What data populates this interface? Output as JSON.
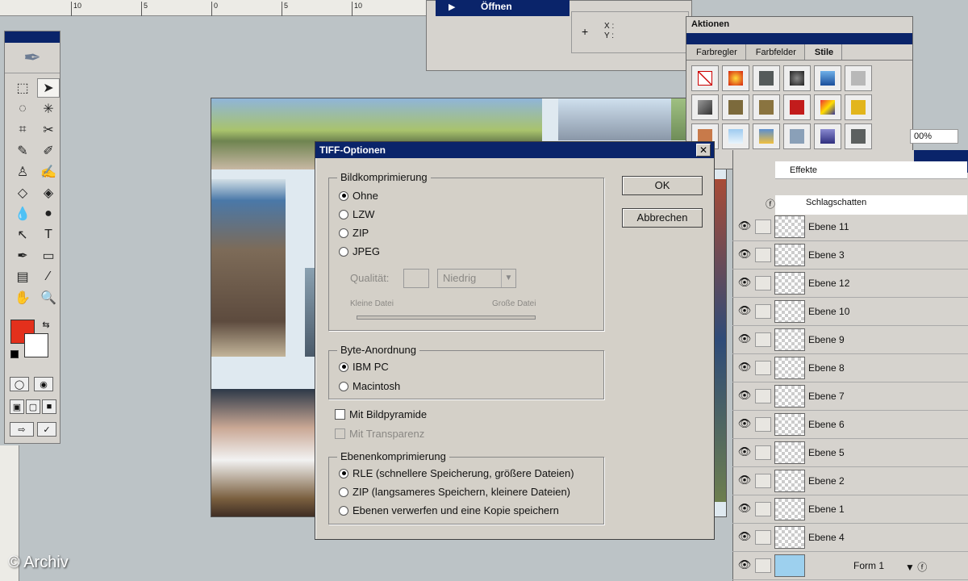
{
  "top_ruler": {
    "labels": [
      "10",
      "5",
      "0",
      "5",
      "10"
    ]
  },
  "top_panel": {
    "open_label": "Öffnen",
    "x_label": "X :",
    "y_label": "Y :"
  },
  "styles_panel": {
    "title": "Aktionen",
    "tabs": [
      "Farbregler",
      "Farbfelder",
      "Stile"
    ],
    "active_tab": "Stile"
  },
  "layers": {
    "effects_label": "Effekte",
    "shadow_label": "Schlagschatten",
    "zoom_text": "00%",
    "rows": [
      "Ebene 11",
      "Ebene 3",
      "Ebene 12",
      "Ebene 10",
      "Ebene 9",
      "Ebene 8",
      "Ebene 7",
      "Ebene 6",
      "Ebene 5",
      "Ebene 2",
      "Ebene 1",
      "Ebene 4",
      "Form 1"
    ]
  },
  "colors": {
    "foreground": "#e3301c",
    "background": "#ffffff",
    "title_bar": "#0a246a"
  },
  "dialog": {
    "title": "TIFF-Optionen",
    "ok_label": "OK",
    "cancel_label": "Abbrechen",
    "compression": {
      "legend": "Bildkomprimierung",
      "options": [
        "Ohne",
        "LZW",
        "ZIP",
        "JPEG"
      ],
      "selected": "Ohne",
      "quality_label": "Qualität:",
      "quality_value": "Niedrig",
      "small_file": "Kleine Datei",
      "large_file": "Große Datei"
    },
    "byte_order": {
      "legend": "Byte-Anordnung",
      "options": [
        "IBM PC",
        "Macintosh"
      ],
      "selected": "IBM PC"
    },
    "pyramid_label": "Mit Bildpyramide",
    "transparency_label": "Mit Transparenz",
    "layer_compression": {
      "legend": "Ebenenkomprimierung",
      "options": [
        "RLE (schnellere Speicherung, größere Dateien)",
        "ZIP (langsameres Speichern, kleinere Dateien)",
        "Ebenen verwerfen und eine Kopie speichern"
      ],
      "selected": "RLE (schnellere Speicherung, größere Dateien)"
    }
  },
  "watermark": "© Archiv"
}
